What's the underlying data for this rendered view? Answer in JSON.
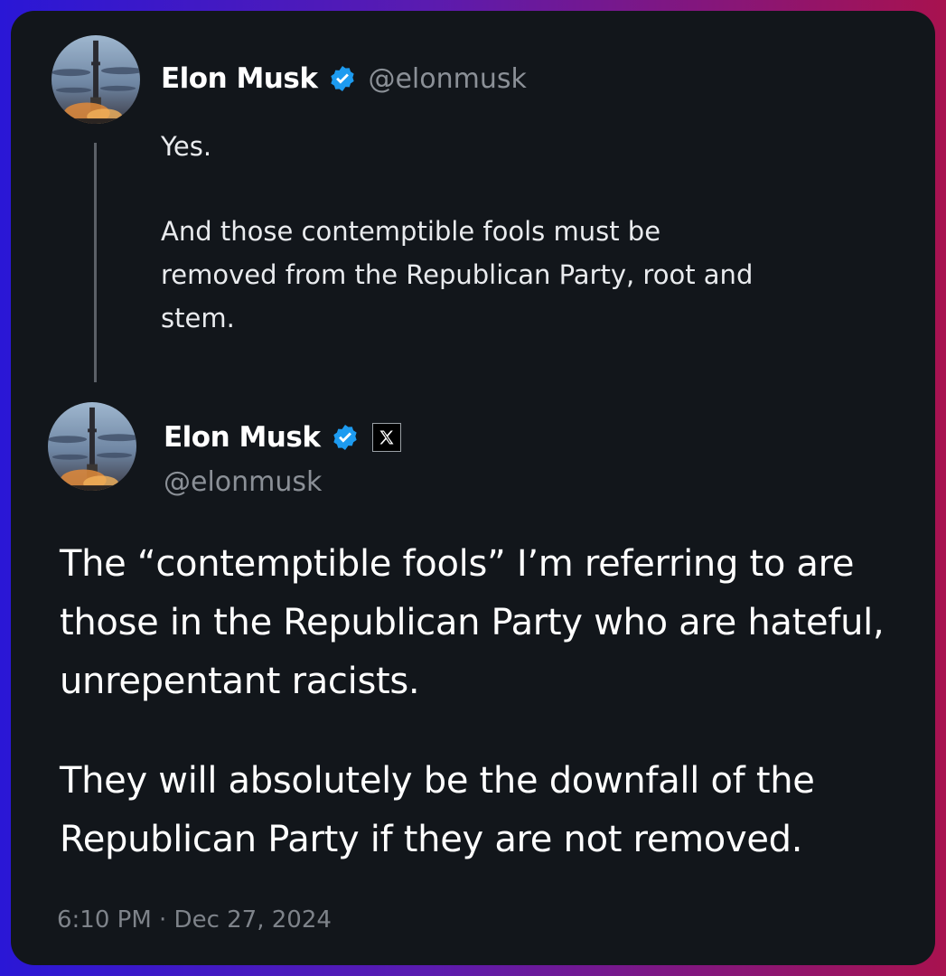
{
  "quoted_post": {
    "author_name": "Elon Musk",
    "author_handle": "@elonmusk",
    "verified_badge_icon": "verified-badge-icon",
    "lines": [
      "Yes.",
      "And those contemptible fools must be",
      "removed from the Republican Party, root and",
      "stem."
    ]
  },
  "main_post": {
    "author_name": "Elon Musk",
    "author_handle": "@elonmusk",
    "verified_badge_icon": "verified-badge-icon",
    "affiliation_icon": "x-logo-icon",
    "paragraph_1": [
      "The “contemptible fools” I’m referring to are",
      "those in the Republican Party who are hateful,",
      "unrepentant racists."
    ],
    "paragraph_2": [
      "They will absolutely be the downfall of the",
      "Republican Party if they are not removed."
    ],
    "timestamp": "6:10 PM · Dec 27, 2024"
  },
  "colors": {
    "card_background": "#12161b",
    "verified_blue": "#1d9bf0",
    "handle_gray": "#8b9097",
    "gradient_left": "#2a17d6",
    "gradient_right": "#a8124f"
  }
}
